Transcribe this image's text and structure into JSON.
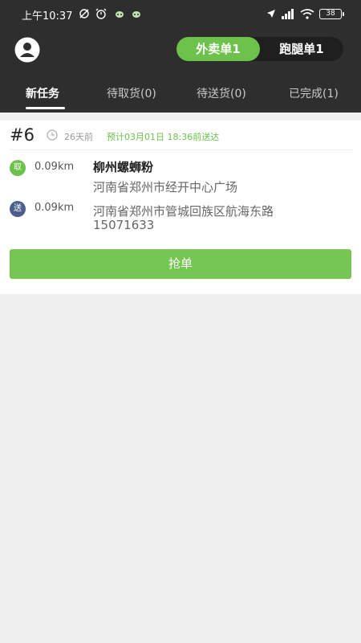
{
  "status_bar": {
    "time": "上午10:37",
    "battery": "38"
  },
  "header": {
    "segments": [
      {
        "label": "外卖单1",
        "active": true
      },
      {
        "label": "跑腿单1",
        "active": false
      }
    ]
  },
  "tabs": [
    {
      "label": "新任务",
      "active": true
    },
    {
      "label": "待取货(0)",
      "active": false
    },
    {
      "label": "待送货(0)",
      "active": false
    },
    {
      "label": "已完成(1)",
      "active": false
    }
  ],
  "order": {
    "number": "#6",
    "time_ago": "26天前",
    "eta": "预计03月01日 18:36前送达",
    "pickup": {
      "badge": "取",
      "distance": "0.09km",
      "name": "柳州螺蛳粉",
      "address": "河南省郑州市经开中心广场"
    },
    "delivery": {
      "badge": "送",
      "distance": "0.09km",
      "address": "河南省郑州市管城回族区航海东路",
      "phone": "15071633"
    },
    "action_label": "抢单"
  },
  "colors": {
    "accent_green": "#6cc24a",
    "header_bg": "#2e2e2e",
    "delivery_badge": "#4a5f8f"
  },
  "icons": [
    "user-icon",
    "clock-icon",
    "alarm-icon",
    "location-arrow-icon",
    "wifi-icon",
    "signal-icon",
    "battery-icon"
  ]
}
